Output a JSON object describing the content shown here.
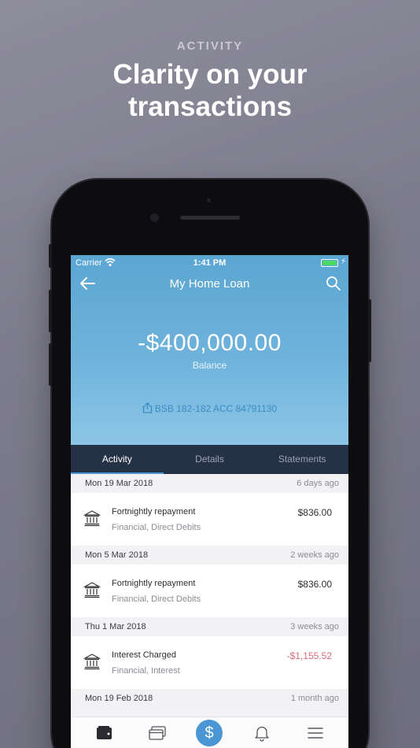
{
  "promo": {
    "kicker": "ACTIVITY",
    "title_line1": "Clarity on your",
    "title_line2": "transactions"
  },
  "status_bar": {
    "carrier": "Carrier",
    "time": "1:41 PM",
    "icons": [
      "wifi-icon",
      "battery-icon",
      "charging-bolt-icon"
    ]
  },
  "nav": {
    "title": "My Home Loan",
    "back_icon": "arrow-left-icon",
    "search_icon": "search-icon"
  },
  "account": {
    "balance": "-$400,000.00",
    "balance_label": "Balance",
    "details": "BSB 182-182  ACC 84791130"
  },
  "tabs": [
    {
      "label": "Activity",
      "active": true
    },
    {
      "label": "Details",
      "active": false
    },
    {
      "label": "Statements",
      "active": false
    }
  ],
  "activity": [
    {
      "date": "Mon 19 Mar 2018",
      "ago": "6 days ago",
      "title": "Fortnightly repayment",
      "category": "Financial, Direct Debits",
      "amount": "$836.00",
      "negative": false
    },
    {
      "date": "Mon 5 Mar 2018",
      "ago": "2 weeks ago",
      "title": "Fortnightly repayment",
      "category": "Financial, Direct Debits",
      "amount": "$836.00",
      "negative": false
    },
    {
      "date": "Thu 1 Mar 2018",
      "ago": "3 weeks ago",
      "title": "Interest Charged",
      "category": "Financial, Interest",
      "amount": "-$1,155.52",
      "negative": true
    },
    {
      "date": "Mon 19 Feb 2018",
      "ago": "1 month ago"
    }
  ],
  "tabbar": {
    "items": [
      "wallet-icon",
      "cards-icon",
      "dollar-icon",
      "bell-icon",
      "menu-icon"
    ],
    "center_symbol": "$"
  },
  "colors": {
    "accent": "#4a95d3",
    "tab_background": "#253146",
    "negative_amount": "#d96a79",
    "hero_top": "#5ba6d3"
  }
}
